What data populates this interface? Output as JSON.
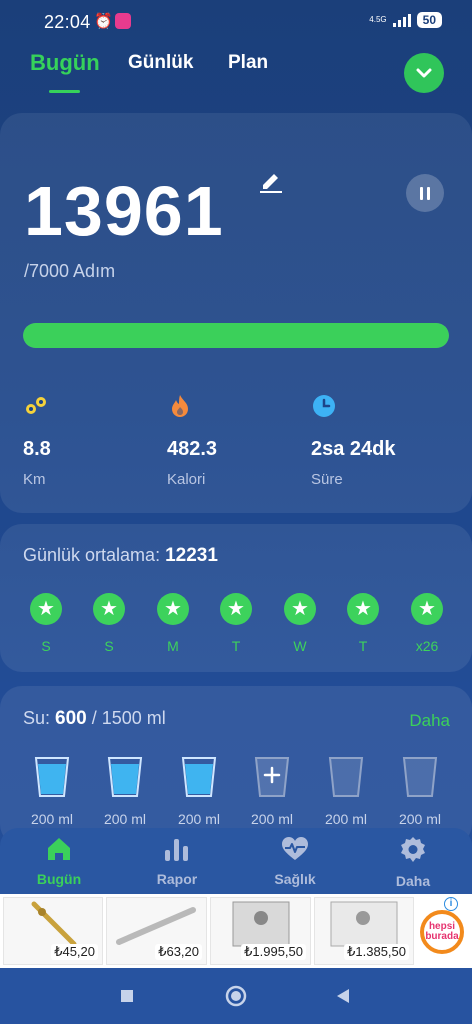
{
  "status_bar": {
    "time": "22:04",
    "network": "4.5G",
    "battery": "50"
  },
  "tabs": [
    {
      "label": "Bugün",
      "active": true
    },
    {
      "label": "Günlük",
      "active": false
    },
    {
      "label": "Plan",
      "active": false
    }
  ],
  "steps": {
    "count": "13961",
    "goal": "/7000 Adım",
    "progress_fraction": 1.0
  },
  "stats": [
    {
      "value": "8.8",
      "label": "Km",
      "icon": "distance-icon",
      "color": "#f5d23b"
    },
    {
      "value": "482.3",
      "label": "Kalori",
      "icon": "flame-icon",
      "color": "#f58a3c"
    },
    {
      "value": "2sa 24dk",
      "label": "Süre",
      "icon": "clock-icon",
      "color": "#3db2f5"
    }
  ],
  "daily_average": {
    "label": "Günlük ortalama:",
    "value": "12231",
    "days": [
      "S",
      "S",
      "M",
      "T",
      "W",
      "T",
      "x26"
    ]
  },
  "water": {
    "label": "Su:",
    "current": "600",
    "target": "/ 1500 ml",
    "more": "Daha",
    "glasses": [
      {
        "label": "200 ml",
        "state": "full"
      },
      {
        "label": "200 ml",
        "state": "full"
      },
      {
        "label": "200 ml",
        "state": "full"
      },
      {
        "label": "200 ml",
        "state": "add"
      },
      {
        "label": "200 ml",
        "state": "empty"
      },
      {
        "label": "200 ml",
        "state": "empty"
      }
    ]
  },
  "bottom_nav": [
    {
      "label": "Bugün",
      "icon": "home-icon",
      "active": true
    },
    {
      "label": "Rapor",
      "icon": "bar-chart-icon",
      "active": false
    },
    {
      "label": "Sağlık",
      "icon": "heart-pulse-icon",
      "active": false
    },
    {
      "label": "Daha",
      "icon": "gear-icon",
      "active": false
    }
  ],
  "ads": {
    "prices": [
      "₺45,20",
      "₺63,20",
      "₺1.995,50",
      "₺1.385,50"
    ],
    "brand": [
      "hepsi",
      "burada"
    ]
  },
  "colors": {
    "accent": "#36d25a",
    "background": "#1d4589"
  }
}
